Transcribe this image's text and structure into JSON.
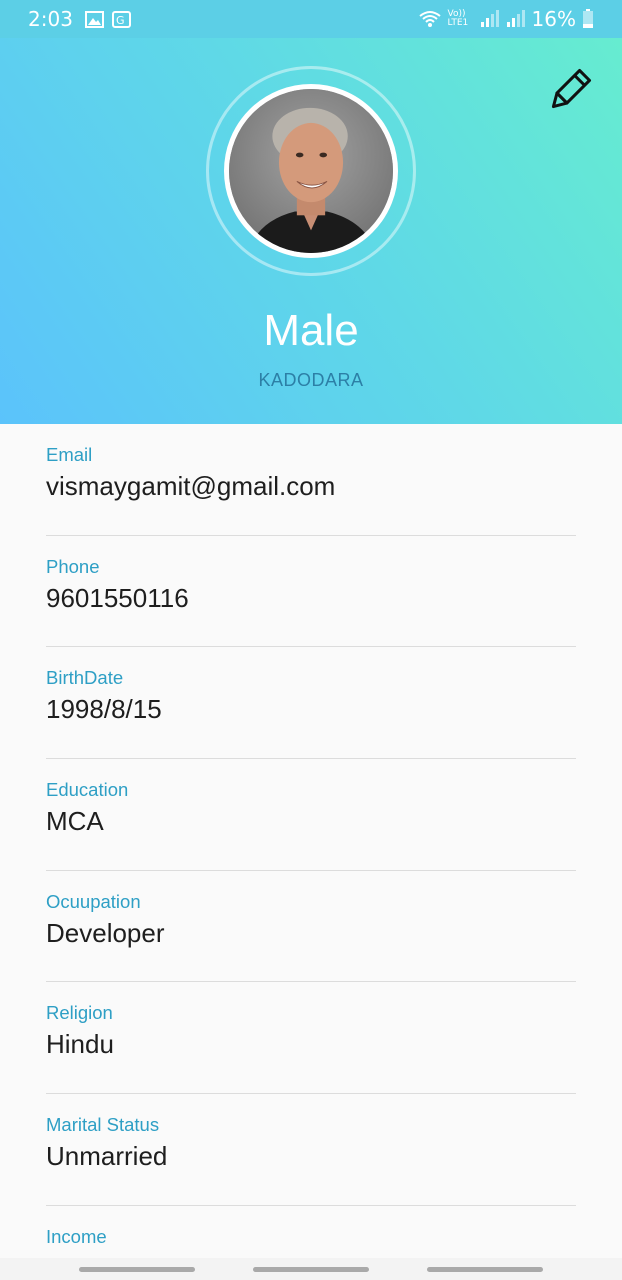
{
  "status_bar": {
    "time": "2:03",
    "battery": "16%",
    "network_label": "Vo)) LTE1",
    "icons": [
      "gallery-icon",
      "translate-icon",
      "wifi-icon",
      "signal-icon",
      "battery-icon"
    ]
  },
  "profile": {
    "name": "Male",
    "subtitle": "KADODARA",
    "edit_icon": "pencil-icon"
  },
  "fields": [
    {
      "label": "Email",
      "value": "vismaygamit@gmail.com"
    },
    {
      "label": "Phone",
      "value": "9601550116"
    },
    {
      "label": "BirthDate",
      "value": "1998/8/15"
    },
    {
      "label": "Education",
      "value": "MCA"
    },
    {
      "label": "Ocuupation",
      "value": "Developer"
    },
    {
      "label": "Religion",
      "value": "Hindu"
    },
    {
      "label": "Marital Status",
      "value": "Unmarried"
    },
    {
      "label": "Income",
      "value": ""
    }
  ],
  "colors": {
    "header_start": "#5bc3fb",
    "header_end": "#66ecd0",
    "label": "#2e9fc5",
    "subtitle": "#2c7fa6"
  }
}
